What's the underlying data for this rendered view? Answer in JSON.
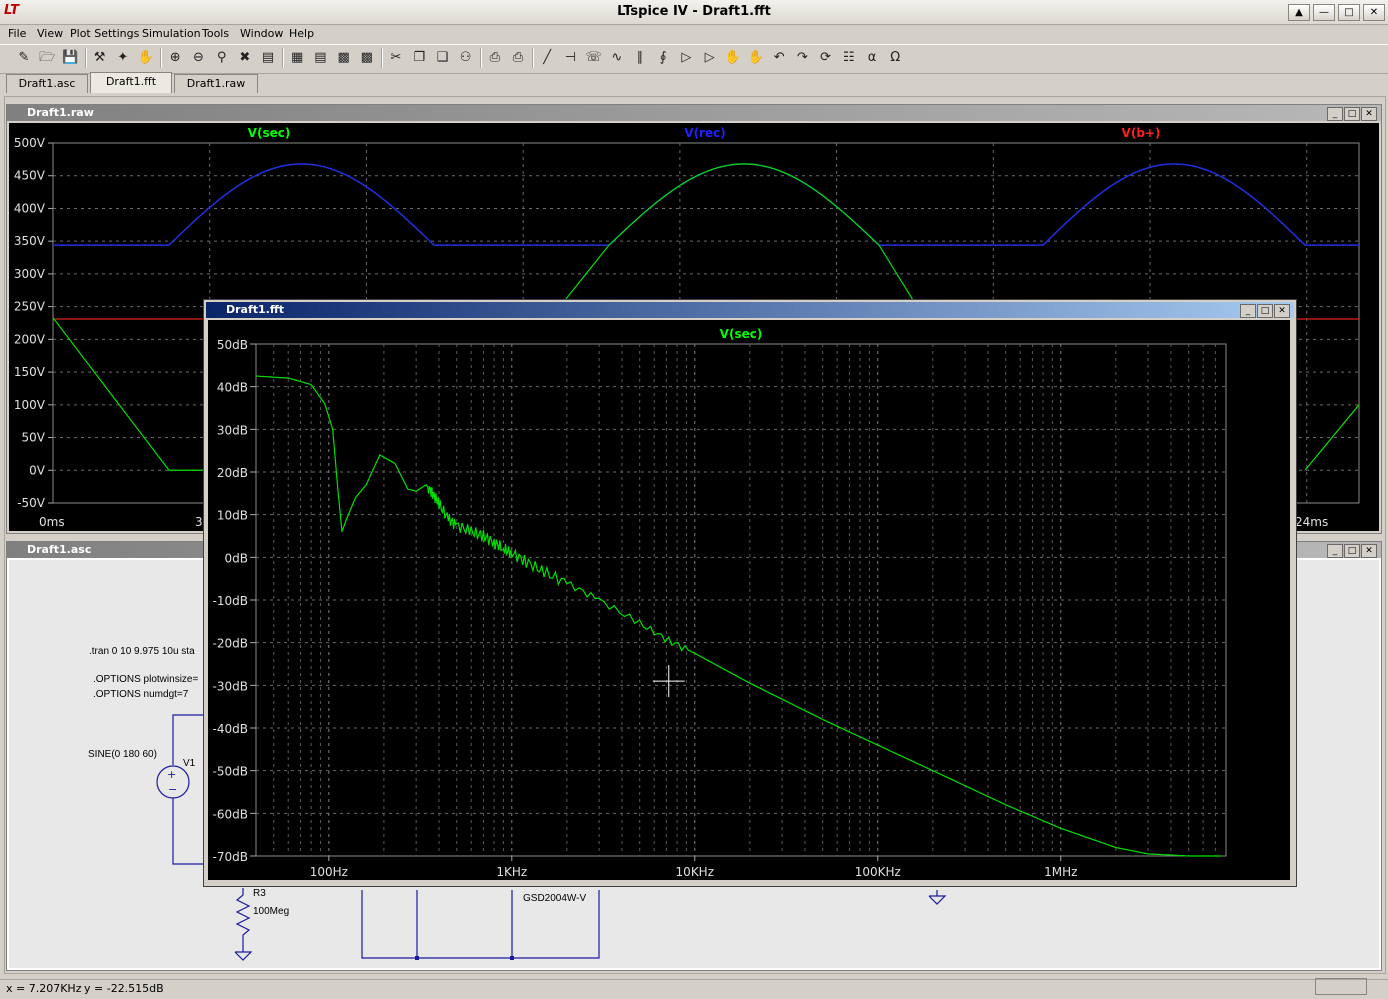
{
  "window": {
    "title": "LTspice IV - Draft1.fft",
    "logo": "LT",
    "controls": [
      "restore-icon",
      "minimize-icon",
      "maximize-icon",
      "close-icon"
    ]
  },
  "menu": [
    {
      "label": "File",
      "key": "F"
    },
    {
      "label": "View",
      "key": "V"
    },
    {
      "label": "Plot Settings",
      "key": "P"
    },
    {
      "label": "Simulation",
      "key": "S"
    },
    {
      "label": "Tools",
      "key": "T"
    },
    {
      "label": "Window",
      "key": "W"
    },
    {
      "label": "Help",
      "key": "H"
    }
  ],
  "toolbar": {
    "icons": [
      "new-schematic-icon",
      "open-icon",
      "save-icon",
      "control-panel-icon",
      "run-icon",
      "halt-icon",
      "zoom-in-icon",
      "zoom-out-icon",
      "zoom-fit-icon",
      "zoom-cancel-icon",
      "autorange-icon",
      "mark-icon",
      "tile-h-icon",
      "cascade-icon",
      "tile-v-icon",
      "cut-icon",
      "copy-icon",
      "paste-icon",
      "find-icon",
      "print-setup-icon",
      "print-icon",
      "wire-icon",
      "ground-icon",
      "label-icon",
      "resistor-icon",
      "capacitor-icon",
      "inductor-icon",
      "diode-icon",
      "component-icon",
      "move-icon",
      "drag-icon",
      "undo-icon",
      "redo-icon",
      "rotate-icon",
      "mirror-icon",
      "text-icon",
      "spice-directive-icon"
    ]
  },
  "tabs": [
    "Draft1.asc",
    "Draft1.fft",
    "Draft1.raw"
  ],
  "active_tab": 1,
  "raw_window": {
    "title": "Draft1.raw",
    "traces": [
      {
        "name": "V(sec)",
        "color": "#00ff00"
      },
      {
        "name": "V(rec)",
        "color": "#2020ff"
      },
      {
        "name": "V(b+)",
        "color": "#ff2020"
      }
    ],
    "y_ticks": [
      "500V",
      "450V",
      "400V",
      "350V",
      "300V",
      "250V",
      "200V",
      "150V",
      "100V",
      "50V",
      "0V",
      "-50V"
    ],
    "x_ticks_visible": [
      "0ms",
      "3",
      "24ms"
    ]
  },
  "asc_window": {
    "title": "Draft1.asc",
    "directives": [
      ".tran 0 10 9.975 10u sta",
      ".OPTIONS plotwinsize=",
      ".OPTIONS numdgt=7"
    ],
    "source_value": "SINE(0 180 60)",
    "source_name": "V1",
    "resistor_name": "R3",
    "resistor_value": "100Meg",
    "diode_model": "GSD2004W-V"
  },
  "chart_data": {
    "type": "line",
    "title": "V(sec)",
    "xscale": "log",
    "xlim": [
      40,
      8000000
    ],
    "ylim": [
      -70,
      50
    ],
    "x_ticks": [
      {
        "value": 100,
        "label": "100Hz"
      },
      {
        "value": 1000,
        "label": "1KHz"
      },
      {
        "value": 10000,
        "label": "10KHz"
      },
      {
        "value": 100000,
        "label": "100KHz"
      },
      {
        "value": 1000000,
        "label": "1MHz"
      }
    ],
    "y_ticks": [
      {
        "value": 50,
        "label": "50dB"
      },
      {
        "value": 40,
        "label": "40dB"
      },
      {
        "value": 30,
        "label": "30dB"
      },
      {
        "value": 20,
        "label": "20dB"
      },
      {
        "value": 10,
        "label": "10dB"
      },
      {
        "value": 0,
        "label": "0dB"
      },
      {
        "value": -10,
        "label": "-10dB"
      },
      {
        "value": -20,
        "label": "-20dB"
      },
      {
        "value": -30,
        "label": "-30dB"
      },
      {
        "value": -40,
        "label": "-40dB"
      },
      {
        "value": -50,
        "label": "-50dB"
      },
      {
        "value": -60,
        "label": "-60dB"
      },
      {
        "value": -70,
        "label": "-70dB"
      }
    ],
    "grid": true,
    "series": [
      {
        "name": "V(sec)",
        "color": "#00ff00",
        "x": [
          40,
          60,
          80,
          95,
          105,
          112,
          118,
          125,
          140,
          160,
          190,
          230,
          270,
          300,
          340,
          370,
          400,
          450,
          500,
          600,
          700,
          800,
          900,
          1000,
          1200,
          1500,
          2000,
          3000,
          5000,
          7200,
          10000,
          20000,
          50000,
          100000,
          200000,
          500000,
          1000000,
          2000000,
          3000000,
          5000000,
          7500000
        ],
        "y": [
          42.5,
          42.0,
          40.5,
          36.0,
          30.0,
          16.0,
          6.0,
          9.0,
          14.0,
          17.0,
          24.0,
          22.0,
          16.0,
          15.5,
          17.0,
          15.0,
          12.5,
          9.0,
          7.5,
          6.0,
          5.0,
          3.5,
          2.0,
          1.0,
          -1.0,
          -3.5,
          -6.0,
          -10.0,
          -15.5,
          -19.5,
          -22.5,
          -29.5,
          -38.0,
          -44.0,
          -50.0,
          -58.0,
          -63.5,
          -68.0,
          -69.5,
          -70.0,
          -70.0
        ]
      }
    ]
  },
  "cursor": {
    "x": 7207,
    "y": -22.515
  },
  "status": {
    "x": "x = 7.207KHz",
    "y": "y = -22.515dB"
  }
}
